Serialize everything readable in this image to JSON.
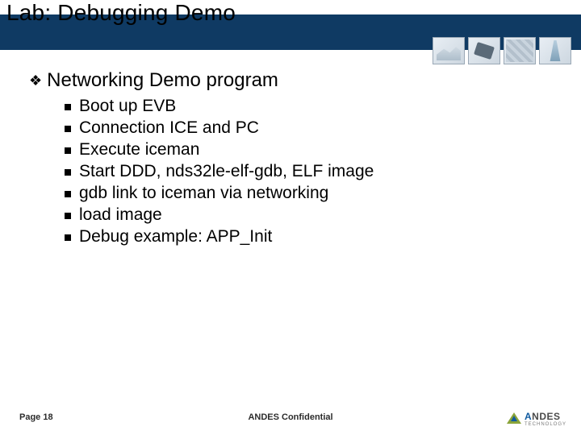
{
  "title": "Lab: Debugging Demo",
  "section": {
    "heading": "Networking Demo program",
    "items": [
      "Boot up EVB",
      "Connection ICE and PC",
      "Execute iceman",
      "Start DDD, nds32le-elf-gdb, ELF image",
      "gdb link to iceman via networking",
      "load image",
      "Debug example: APP_Init"
    ]
  },
  "footer": {
    "page_label": "Page 18",
    "confidential": "ANDES Confidential"
  },
  "logo": {
    "first_letter": "A",
    "rest": "NDES",
    "subtitle": "TECHNOLOGY"
  }
}
